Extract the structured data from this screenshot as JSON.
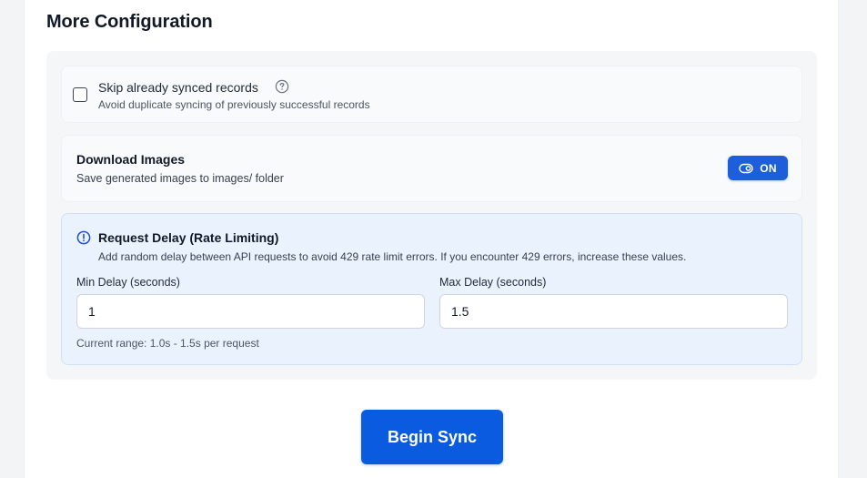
{
  "section": {
    "title": "More Configuration"
  },
  "skip_synced": {
    "title": "Skip already synced records",
    "description": "Avoid duplicate syncing of previously successful records",
    "checked": false,
    "help_icon": "question-circle-icon"
  },
  "download_images": {
    "title": "Download Images",
    "description": "Save generated images to images/ folder",
    "toggle_label": "ON",
    "toggle_icon": "eye-icon",
    "enabled": true
  },
  "request_delay": {
    "title": "Request Delay (Rate Limiting)",
    "description": "Add random delay between API requests to avoid 429 rate limit errors. If you encounter 429 errors, increase these values.",
    "info_icon": "info-circle-icon",
    "min_label": "Min Delay (seconds)",
    "min_value": "1",
    "max_label": "Max Delay (seconds)",
    "max_value": "1.5",
    "range_note": "Current range: 1.0s - 1.5s per request"
  },
  "actions": {
    "begin_label": "Begin Sync"
  },
  "colors": {
    "primary": "#0a5be0",
    "toggle": "#1d5fdb",
    "info_bg": "#eaf3fd",
    "info_icon": "#1d4ed8",
    "panel_bg": "#f5f6f8"
  }
}
